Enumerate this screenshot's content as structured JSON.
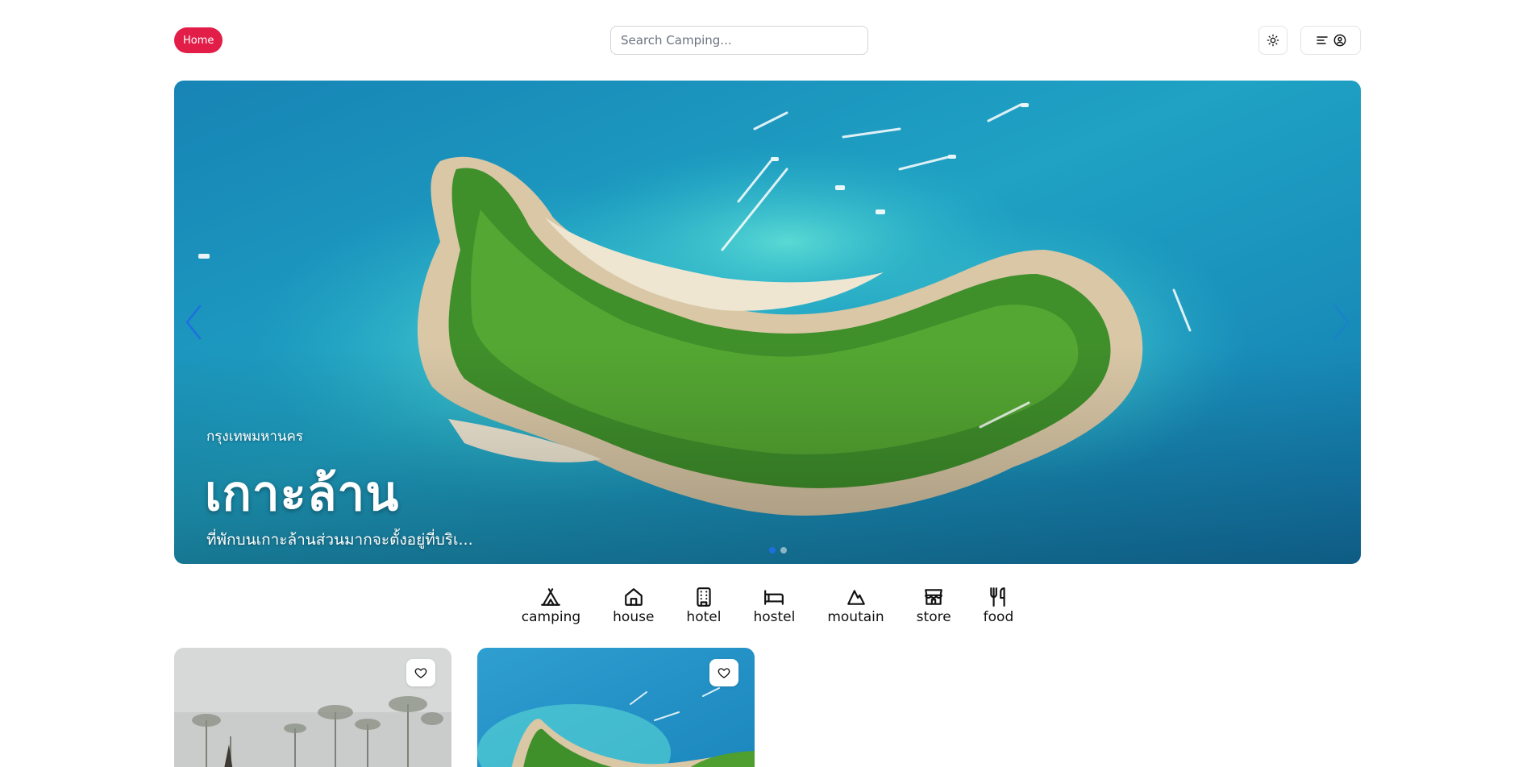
{
  "header": {
    "home_label": "Home",
    "search_placeholder": "Search Camping...",
    "accent_color": "#e11d48"
  },
  "hero": {
    "province": "กรุงเทพมหานคร",
    "title": "เกาะล้าน",
    "description": "ที่พักบนเกาะล้านส่วนมากจะตั้งอยู่ที่บริเ...",
    "active_slide": 1,
    "slide_count": 2
  },
  "categories": [
    {
      "label": "camping",
      "icon": "tent-icon"
    },
    {
      "label": "house",
      "icon": "house-icon"
    },
    {
      "label": "hotel",
      "icon": "building-icon"
    },
    {
      "label": "hostel",
      "icon": "bed-icon"
    },
    {
      "label": "moutain",
      "icon": "mountain-icon"
    },
    {
      "label": "store",
      "icon": "store-icon"
    },
    {
      "label": "food",
      "icon": "utensils-icon"
    }
  ]
}
